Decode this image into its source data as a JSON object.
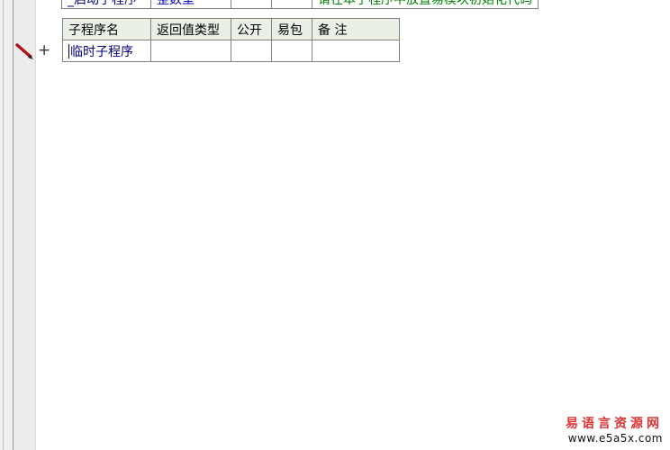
{
  "prev_row": {
    "marker": "+",
    "name": "_启动子程序",
    "return_type": "整数型",
    "public": "",
    "easy_pack": "",
    "remark": "请在本子程序中放置易模块初始化代码"
  },
  "subprogram_table": {
    "headers": [
      "子程序名",
      "返回值类型",
      "公开",
      "易包",
      "备 注"
    ],
    "row": {
      "name": "临时子程序",
      "return_type": "",
      "public": "",
      "easy_pack": "",
      "remark": ""
    }
  },
  "row_marker": "+",
  "icons": {
    "edit": "pen-icon"
  },
  "watermark": {
    "title": "易语言资源网",
    "url": "www.e5a5x.com"
  }
}
